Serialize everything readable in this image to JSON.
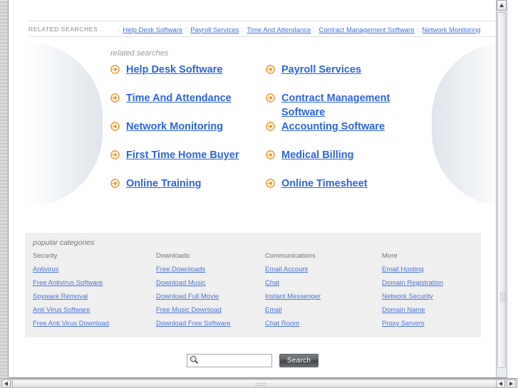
{
  "topbar": {
    "label": "RELATED SEARCHES",
    "separator": "::",
    "links": [
      "Help Desk Software",
      "Payroll Services",
      "Time And Attendance",
      "Contract Management Software",
      "Network Monitoring"
    ]
  },
  "related_searches": {
    "title": "related searches",
    "arrow_icon": "arrow-circle-right-icon",
    "items": [
      "Help Desk Software",
      "Payroll Services",
      "Time And Attendance",
      "Contract Management Software",
      "Network Monitoring",
      "Accounting Software",
      "First Time Home Buyer",
      "Medical Billing",
      "Online Training",
      "Online Timesheet"
    ]
  },
  "popular_categories": {
    "title": "popular categories",
    "columns": [
      {
        "heading": "Security",
        "links": [
          "Antivirus",
          "Free Antivirus Software",
          "Spyware Removal",
          "Anti Virus Software",
          "Free Anti Virus Download"
        ]
      },
      {
        "heading": "Downloads",
        "links": [
          "Free Downloads",
          "Download Music",
          "Download Full Movie",
          "Free Music Download",
          "Download Free Software"
        ]
      },
      {
        "heading": "Communications",
        "links": [
          "Email Account",
          "Chat",
          "Instant Messenger",
          "Email",
          "Chat Room"
        ]
      },
      {
        "heading": "More",
        "links": [
          "Email Hosting",
          "Domain Registration",
          "Network Security",
          "Domain Name",
          "Proxy Servers"
        ]
      }
    ]
  },
  "search": {
    "value": "",
    "placeholder": "",
    "button_label": "Search",
    "icon": "magnifier-icon"
  },
  "scrollbars": {
    "vertical_up_icon": "triangle-up-icon",
    "horizontal_left_icon": "triangle-left-icon",
    "horizontal_right_icon": "triangle-right-icon"
  },
  "colors": {
    "link_blue": "#2b63e0",
    "small_link_blue": "#4a74d8",
    "arrow_orange": "#e8921b",
    "panel_gray": "#efefef"
  }
}
